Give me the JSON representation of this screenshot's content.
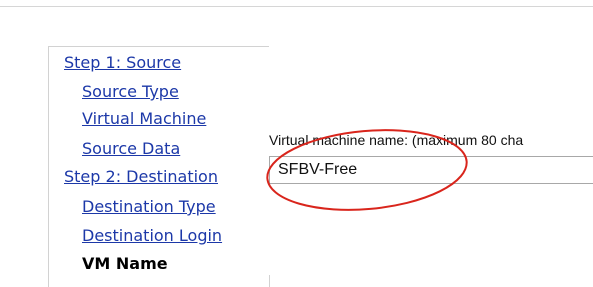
{
  "theme": {
    "link_color": "#1c38a8",
    "annotation_color": "#d9251c"
  },
  "wizard_nav": {
    "items": [
      {
        "label": "Step 1: Source",
        "state": "link"
      },
      {
        "label": "Source Type",
        "state": "link"
      },
      {
        "label": "Virtual Machine",
        "state": "link"
      },
      {
        "label": "Source Data",
        "state": "link"
      },
      {
        "label": "Step 2: Destination",
        "state": "link"
      },
      {
        "label": "Destination Type",
        "state": "link"
      },
      {
        "label": "Destination Login",
        "state": "link"
      },
      {
        "label": "VM Name",
        "state": "current"
      }
    ]
  },
  "main": {
    "field_label": "Virtual machine name: (maximum 80 cha",
    "vm_name_value": "SFBV-Free"
  },
  "annotation": {
    "shape": "ellipse-circle-highlight"
  }
}
